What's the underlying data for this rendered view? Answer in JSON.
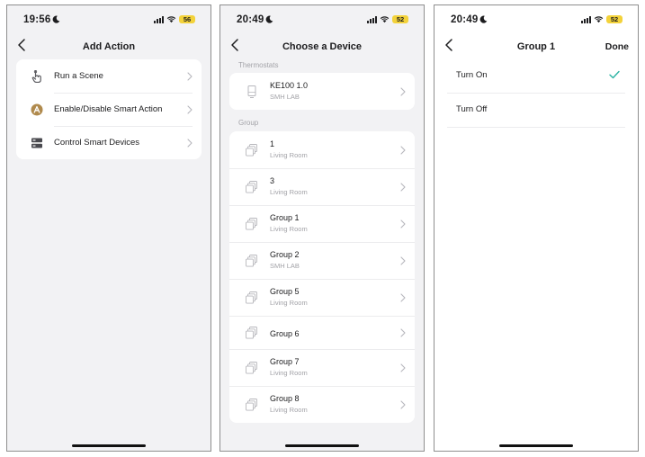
{
  "screens": [
    {
      "status": {
        "time": "19:56",
        "battery": "56"
      },
      "title": "Add Action",
      "items": [
        {
          "label": "Run a Scene",
          "icon": "scene-hand-icon"
        },
        {
          "label": "Enable/Disable Smart Action",
          "icon": "smart-action-icon"
        },
        {
          "label": "Control Smart Devices",
          "icon": "smart-devices-icon"
        }
      ]
    },
    {
      "status": {
        "time": "20:49",
        "battery": "52"
      },
      "title": "Choose a Device",
      "thermostats_label": "Thermostats",
      "thermostats": [
        {
          "name": "KE100 1.0",
          "room": "SMH LAB"
        }
      ],
      "group_label": "Group",
      "groups": [
        {
          "name": "1",
          "room": "Living Room"
        },
        {
          "name": "3",
          "room": "Living Room"
        },
        {
          "name": "Group 1",
          "room": "Living Room"
        },
        {
          "name": "Group 2",
          "room": "SMH LAB"
        },
        {
          "name": "Group 5",
          "room": "Living Room"
        },
        {
          "name": "Group 6",
          "room": ""
        },
        {
          "name": "Group 7",
          "room": "Living Room"
        },
        {
          "name": "Group 8",
          "room": "Living Room"
        }
      ]
    },
    {
      "status": {
        "time": "20:49",
        "battery": "52"
      },
      "title": "Group 1",
      "done_label": "Done",
      "options": [
        {
          "label": "Turn On",
          "selected": true
        },
        {
          "label": "Turn Off",
          "selected": false
        }
      ]
    }
  ],
  "colors": {
    "accent_check": "#2bb3a3",
    "battery": "#f3d23a",
    "scene_icon_bg": "#b08a4d"
  }
}
